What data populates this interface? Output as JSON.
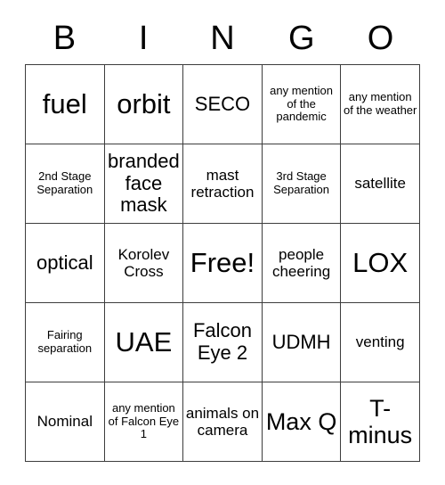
{
  "card": {
    "title": "BINGO",
    "header_letters": [
      "B",
      "I",
      "N",
      "G",
      "O"
    ],
    "free_space_label": "Free!",
    "colors": {
      "background": "#ffffff",
      "border": "#3d3d3d",
      "text": "#000000"
    },
    "rows": [
      [
        {
          "text": "fuel",
          "size": "xl"
        },
        {
          "text": "orbit",
          "size": "xl"
        },
        {
          "text": "SECO",
          "size": "md"
        },
        {
          "text": "any mention of the pandemic",
          "size": "xs"
        },
        {
          "text": "any mention of the weather",
          "size": "xs"
        }
      ],
      [
        {
          "text": "2nd Stage Separation",
          "size": "xs"
        },
        {
          "text": "branded face mask",
          "size": "md"
        },
        {
          "text": "mast retraction",
          "size": "sm"
        },
        {
          "text": "3rd Stage Separation",
          "size": "xs"
        },
        {
          "text": "satellite",
          "size": "sm"
        }
      ],
      [
        {
          "text": "optical",
          "size": "md"
        },
        {
          "text": "Korolev Cross",
          "size": "sm"
        },
        {
          "text": "Free!",
          "size": "xl"
        },
        {
          "text": "people cheering",
          "size": "sm"
        },
        {
          "text": "LOX",
          "size": "xl"
        }
      ],
      [
        {
          "text": "Fairing separation",
          "size": "xs"
        },
        {
          "text": "UAE",
          "size": "xl"
        },
        {
          "text": "Falcon Eye 2",
          "size": "md"
        },
        {
          "text": "UDMH",
          "size": "md"
        },
        {
          "text": "venting",
          "size": "sm"
        }
      ],
      [
        {
          "text": "Nominal",
          "size": "sm"
        },
        {
          "text": "any mention of Falcon Eye 1",
          "size": "xs"
        },
        {
          "text": "animals on camera",
          "size": "sm"
        },
        {
          "text": "Max Q",
          "size": "lg"
        },
        {
          "text": "T-minus",
          "size": "lg"
        }
      ]
    ]
  }
}
